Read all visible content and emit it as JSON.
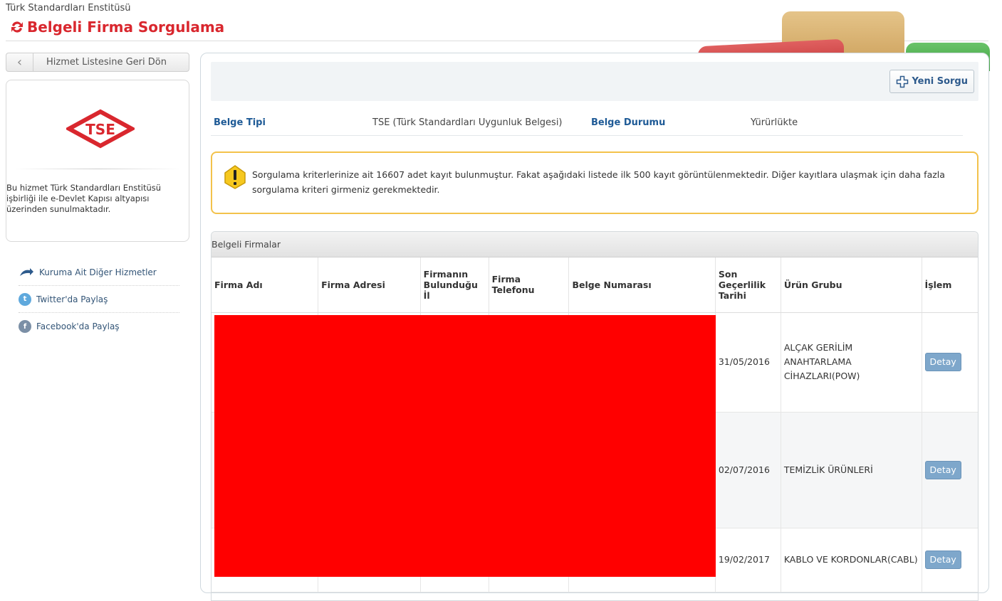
{
  "header": {
    "org_name": "Türk Standardları Enstitüsü",
    "page_title": "Belgeli Firma Sorgulama"
  },
  "sidebar": {
    "back_label": "Hizmet Listesine Geri Dön",
    "card_text": "Bu hizmet Türk Standardları Enstitüsü işbirliği ile e-Devlet Kapısı altyapısı üzerinden sunulmaktadır.",
    "logo_text": "TSE",
    "links": [
      {
        "label": "Kuruma Ait Diğer Hizmetler",
        "icon": "arrow-icon"
      },
      {
        "label": "Twitter'da Paylaş",
        "icon": "twitter-icon"
      },
      {
        "label": "Facebook'da Paylaş",
        "icon": "facebook-icon"
      }
    ]
  },
  "toolbar": {
    "new_query_label": "Yeni Sorgu"
  },
  "meta": {
    "doc_type_label": "Belge Tipi",
    "doc_type_value": "TSE (Türk Standardları Uygunluk Belgesi)",
    "doc_status_label": "Belge Durumu",
    "doc_status_value": "Yürürlükte"
  },
  "warning": {
    "text": "Sorgulama kriterlerinize ait 16607 adet kayıt bulunmuştur. Fakat aşağıdaki listede ilk 500 kayıt görüntülenmektedir. Diğer kayıtlara ulaşmak için daha fazla sorgulama kriteri girmeniz gerekmektedir."
  },
  "table": {
    "caption": "Belgeli Firmalar",
    "columns": [
      "Firma Adı",
      "Firma Adresi",
      "Firmanın Bulunduğu İl",
      "Firma Telefonu",
      "Belge Numarası",
      "Son Geçerlilik Tarihi",
      "Ürün Grubu",
      "İşlem"
    ],
    "rows": [
      {
        "date": "31/05/2016",
        "product": "ALÇAK GERİLİM ANAHTARLAMA CİHAZLARI(POW)",
        "action": "Detay"
      },
      {
        "date": "02/07/2016",
        "product": "TEMİZLİK ÜRÜNLERİ",
        "action": "Detay"
      },
      {
        "date": "19/02/2017",
        "product": "KABLO VE KORDONLAR(CABL)",
        "action": "Detay"
      }
    ]
  },
  "colors": {
    "brand_red": "#d9272e",
    "link_blue": "#1e5a96",
    "warning_border": "#f3c24b",
    "detail_button": "#7ea7cb",
    "redaction": "#ff0000"
  }
}
